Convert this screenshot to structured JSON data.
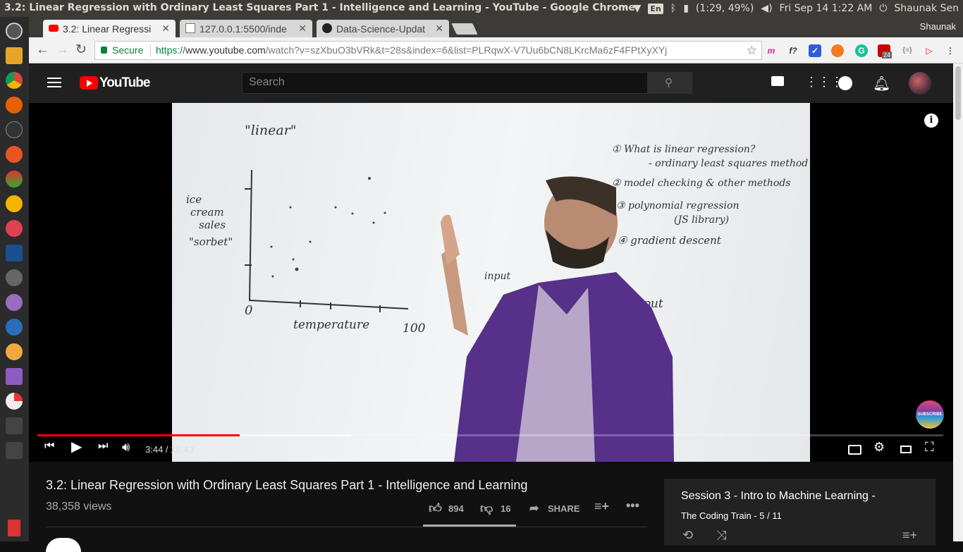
{
  "os": {
    "window_title": "3.2: Linear Regression with Ordinary Least Squares Part 1 - Intelligence and Learning - YouTube - Google Chrome",
    "lang": "En",
    "battery": "(1:29, 49%)",
    "datetime": "Fri Sep 14  1:22 AM",
    "user": "Shaunak Sen"
  },
  "tabs": [
    {
      "label": "3.2: Linear Regressi"
    },
    {
      "label": "127.0.0.1:5500/inde"
    },
    {
      "label": "Data-Science-Updat"
    }
  ],
  "profile": "Shaunak",
  "omnibox": {
    "secure": "Secure",
    "scheme": "https://",
    "host": "www.youtube.com",
    "path": "/watch?v=szXbuO3bVRk&t=28s&index=6&list=PLRqwX-V7Uu6bCN8LKrcMa6zF4FPtXyXYj"
  },
  "ext_badge": "24",
  "youtube": {
    "logo": "YouTube",
    "search_placeholder": "Search"
  },
  "player": {
    "current": "3:44",
    "duration": "16:43",
    "progress": 0.2234,
    "buffered": 0.3465,
    "subscribe_badge": "SUBSCRIBE"
  },
  "whiteboard": {
    "quote": "\"linear\"",
    "ylabel": [
      "ice",
      "cream",
      "sales",
      "\"sorbet\""
    ],
    "origin": "0",
    "xmax": "100",
    "xlabel": "temperature",
    "input": "input",
    "output": "output",
    "topics": [
      "① What is linear regression?",
      "- ordinary least squares method",
      "② model checking & other methods",
      "③ polynomial regression",
      "(JS library)",
      "④ gradient descent"
    ]
  },
  "video": {
    "title": "3.2: Linear Regression with Ordinary Least Squares Part 1 - Intelligence and Learning",
    "views": "38,358 views",
    "likes": "894",
    "dislikes": "16",
    "share": "SHARE"
  },
  "playlist": {
    "title": "Session 3 - Intro to Machine Learning -",
    "subtitle": "The Coding Train - 5 / 11"
  },
  "colors": {
    "yt_red": "#ff0000",
    "secure_green": "#0b8043",
    "yt_bg": "#202020"
  }
}
